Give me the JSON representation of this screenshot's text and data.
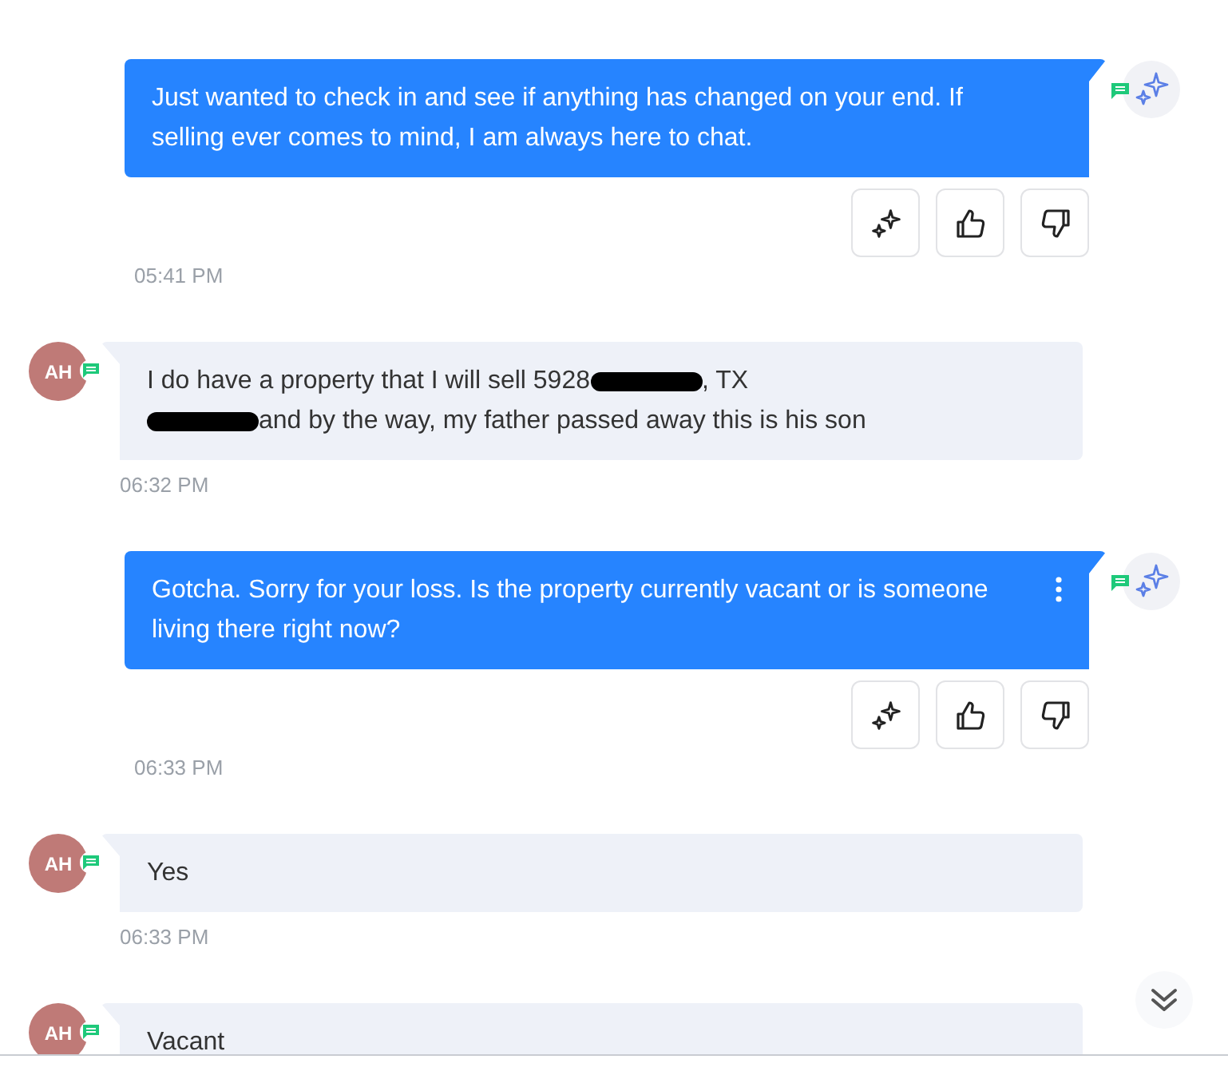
{
  "messages": [
    {
      "kind": "outgoing",
      "text": "Just wanted to check in and see if anything has changed on your end. If selling ever comes to mind, I am always here to chat.",
      "menu": false,
      "time": "05:41 PM"
    },
    {
      "kind": "incoming",
      "avatar": "AH",
      "segments": [
        {
          "kind": "text",
          "text": "I do have a property that I will sell 5928"
        },
        {
          "kind": "redaction"
        },
        {
          "kind": "text",
          "text": ", TX"
        },
        {
          "kind": "break"
        },
        {
          "kind": "redaction"
        },
        {
          "kind": "text",
          "text": "and by the way, my father passed away this is his son"
        }
      ],
      "time": "06:32 PM"
    },
    {
      "kind": "outgoing",
      "text": "Gotcha. Sorry for your loss. Is the property currently vacant or is someone living there right now?",
      "menu": true,
      "time": "06:33 PM"
    },
    {
      "kind": "incoming",
      "avatar": "AH",
      "segments": [
        {
          "kind": "text",
          "text": "Yes"
        }
      ],
      "time": "06:33 PM"
    },
    {
      "kind": "incoming",
      "avatar": "AH",
      "segments": [
        {
          "kind": "text",
          "text": "Vacant"
        }
      ]
    }
  ]
}
